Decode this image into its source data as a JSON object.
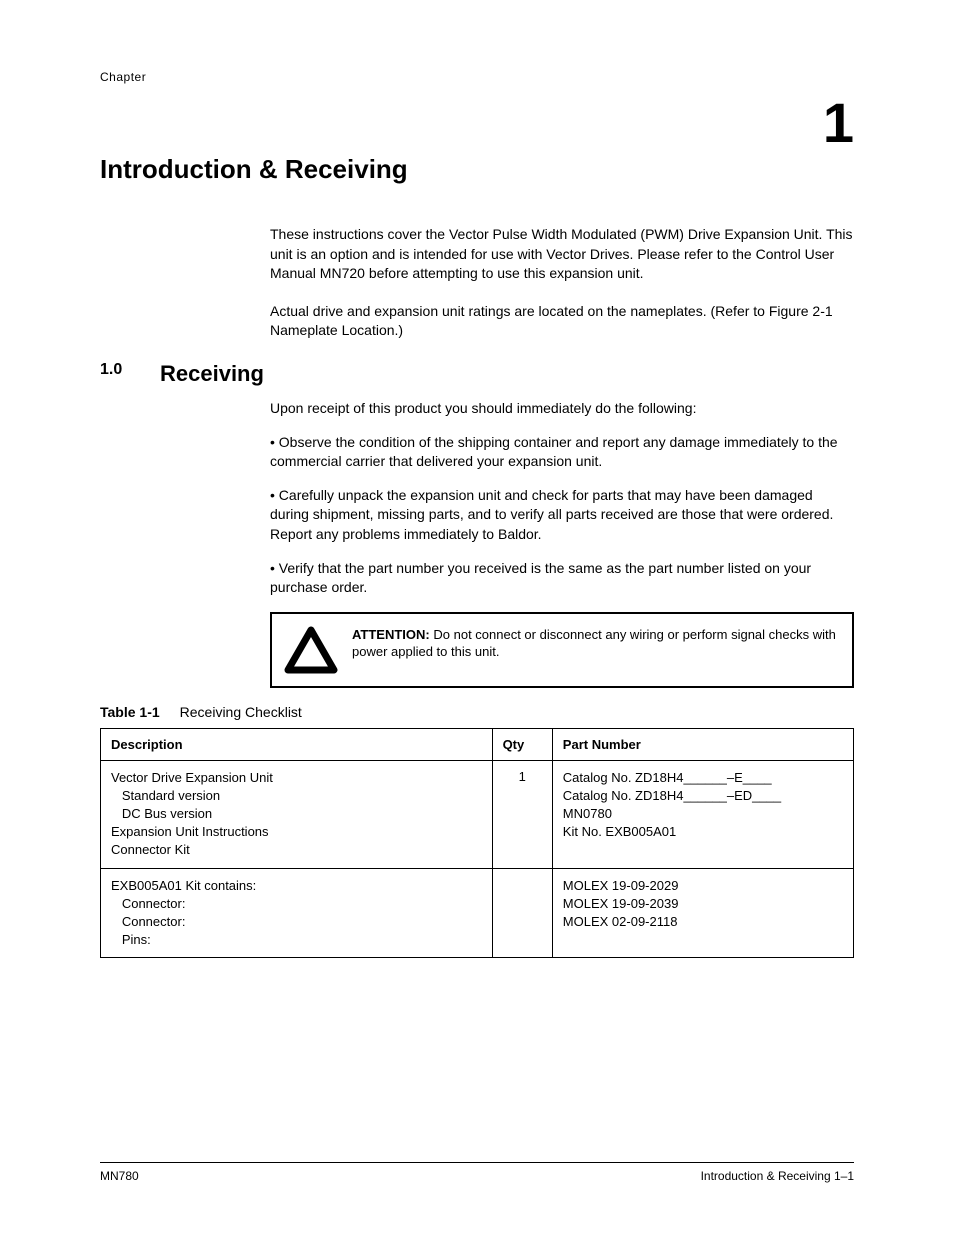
{
  "header": {
    "chapter_label": "Chapter",
    "chapter_number": "1",
    "chapter_title": "Introduction & Receiving"
  },
  "intro": {
    "p1": "These instructions cover the Vector Pulse Width Modulated (PWM) Drive Expansion Unit. This unit is an option and is intended for use with Vector Drives. Please refer to the Control User Manual MN720 before attempting to use this expansion unit.",
    "p2": "Actual drive and expansion unit ratings are located on the nameplates. (Refer to Figure 2-1 Nameplate Location.)"
  },
  "section": {
    "number": "1.0",
    "title": "Receiving",
    "p1": "Upon receipt of this product you should immediately do the following:",
    "b1": "• Observe the condition of the shipping container and report any damage immediately to the commercial carrier that delivered your expansion unit.",
    "b2": "• Carefully unpack the expansion unit and check for parts that may have been damaged during shipment, missing parts, and to verify all parts received are those that were ordered. Report any problems immediately to Baldor.",
    "b3": "• Verify that the part number you received is the same as the part number listed on your purchase order."
  },
  "attention": {
    "label": "ATTENTION:",
    "text": "Do not connect or disconnect any wiring or perform signal checks with power applied to this unit."
  },
  "table": {
    "caption_label": "Table 1-1",
    "caption_text": "Receiving Checklist",
    "headers": {
      "c1": "Description",
      "c2": "Qty",
      "c3": "Part Number"
    },
    "rows": [
      {
        "desc": [
          "Vector Drive Expansion Unit",
          "   Standard version",
          "   DC Bus version",
          "Expansion Unit Instructions",
          "Connector Kit"
        ],
        "qty": "1",
        "part": [
          "",
          "Catalog No. ZD18H4______–E____",
          "Catalog No. ZD18H4______–ED____",
          "MN0780",
          "Kit No. EXB005A01"
        ]
      },
      {
        "desc": [
          "EXB005A01 Kit contains:",
          "   Connector:",
          "   Connector:",
          "   Pins:"
        ],
        "qty": "",
        "part": [
          "",
          "MOLEX 19-09-2029",
          "MOLEX 19-09-2039",
          "MOLEX 02-09-2118"
        ]
      }
    ]
  },
  "footer": {
    "left": "MN780",
    "right": "Introduction & Receiving 1–1"
  }
}
